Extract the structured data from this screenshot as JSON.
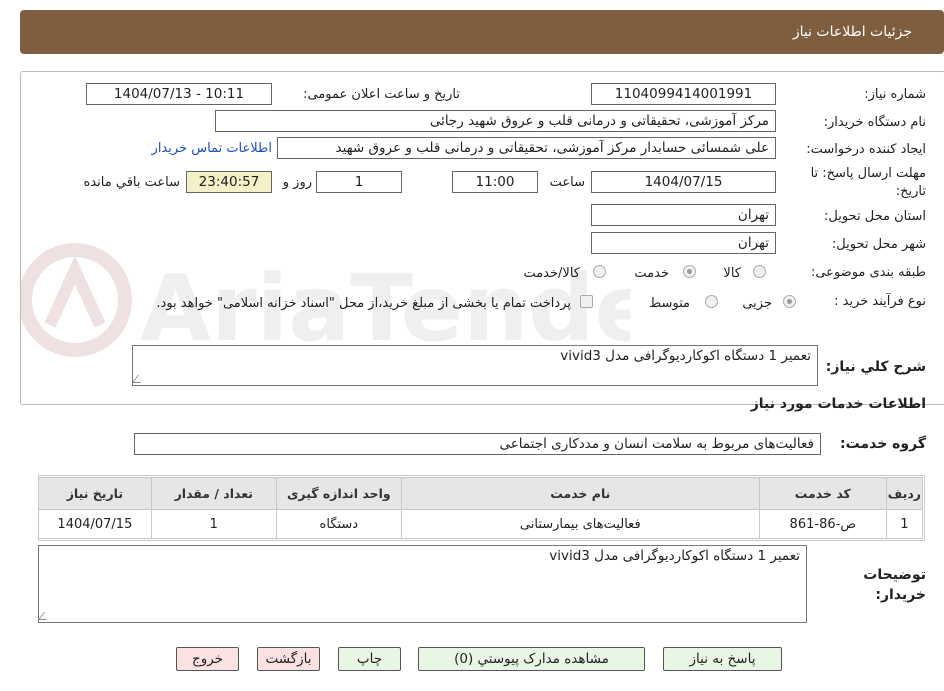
{
  "header": {
    "title": "جزئیات اطلاعات نیاز"
  },
  "fields": {
    "need_number_label": "شماره نیاز:",
    "need_number": "1104099414001991",
    "announce_label": "تاریخ و ساعت اعلان عمومی:",
    "announce_value": "1404/07/13 - 10:11",
    "buyer_org_label": "نام دستگاه خریدار:",
    "buyer_org": "مرکز آموزشی، تحقیقاتی و درمانی قلب و عروق شهید رجائی",
    "requester_label": "ایجاد کننده درخواست:",
    "requester": "علی شمسائی حسابدار مرکز آموزشی، تحقیقاتی و درمانی قلب و عروق شهید",
    "contact_link": "اطلاعات تماس خریدار",
    "deadline_label": "مهلت ارسال پاسخ: تا تاریخ:",
    "deadline_date": "1404/07/15",
    "time_label": "ساعت",
    "deadline_time": "11:00",
    "days_value": "1",
    "days_label": "روز و",
    "remaining_value": "23:40:57",
    "remaining_label": "ساعت باقي مانده",
    "province_label": "استان محل تحویل:",
    "province": "تهران",
    "city_label": "شهر محل تحویل:",
    "city": "تهران",
    "category_label": "طبقه بندی موضوعی:",
    "category_options": [
      "کالا",
      "خدمت",
      "کالا/خدمت"
    ],
    "category_selected": "خدمت",
    "process_label": "نوع فرآیند خرید :",
    "process_options": [
      "جزیی",
      "متوسط"
    ],
    "process_selected": "جزیی",
    "treasury_note": "پرداخت تمام یا بخشی از مبلغ خرید،از محل \"اسناد خزانه اسلامی\" خواهد بود."
  },
  "general_desc": {
    "label": "شرح کلي نياز:",
    "value": "تعمیر 1 دستگاه اکوکاردیوگرافی مدل vivid3"
  },
  "services_section": {
    "title": "اطلاعات خدمات مورد نياز",
    "group_label": "گروه خدمت:",
    "group_value": "فعالیت‌های مربوط به سلامت انسان و مددکاری اجتماعی",
    "columns": [
      "رديف",
      "کد خدمت",
      "نام خدمت",
      "واحد اندازه گیری",
      "تعداد / مقدار",
      "تاریخ نیاز"
    ],
    "rows": [
      [
        "1",
        "ص-86-861",
        "فعالیت‌های بیمارستانی",
        "دستگاه",
        "1",
        "1404/07/15"
      ]
    ]
  },
  "buyer_notes": {
    "label": "توضیحات خریدار:",
    "value": "تعمیر 1 دستگاه اکوکاردیوگرافی مدل vivid3"
  },
  "buttons": {
    "reply": "پاسخ به نیاز",
    "attachments": "مشاهده مدارک پیوستي (0)",
    "print": "چاپ",
    "back": "بازگشت",
    "exit": "خروج"
  },
  "watermark": "AriaTender.neT",
  "colors": {
    "header_bg": "#7f5e3f",
    "remaining_bg": "#f6f0c8",
    "btn_green": "#e8f6e4",
    "btn_red": "#fbe1e1",
    "link": "#1f4fbf"
  }
}
